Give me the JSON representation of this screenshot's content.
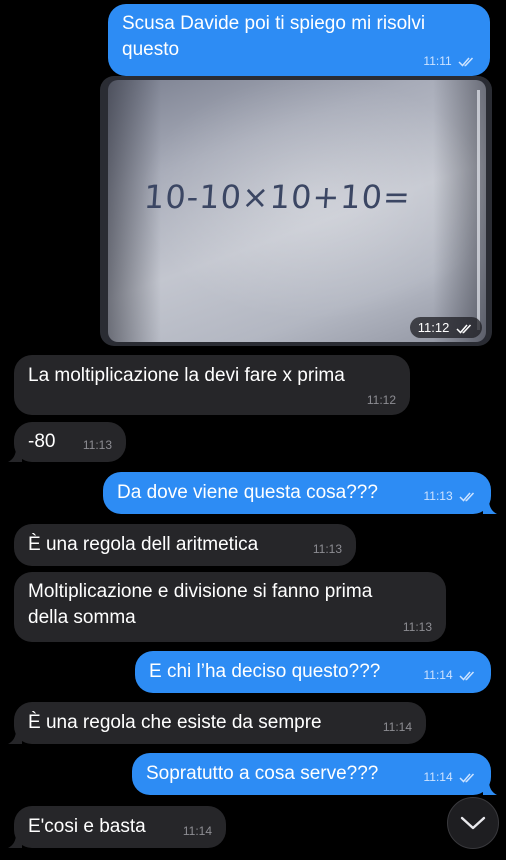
{
  "messages": [
    {
      "text": "Scusa Davide poi ti spiego mi risolvi\nquesto",
      "time": "11:11"
    },
    {
      "photo_text": "10-10×10+10=",
      "time": "11:12"
    },
    {
      "text": "La moltiplicazione la devi fare x prima",
      "time": "11:12"
    },
    {
      "text": "-80",
      "time": "11:13"
    },
    {
      "text": "Da dove viene questa cosa???",
      "time": "11:13"
    },
    {
      "text": "È una regola dell aritmetica",
      "time": "11:13"
    },
    {
      "text": "Moltiplicazione e divisione si fanno prima\ndella somma",
      "time": "11:13"
    },
    {
      "text": "E chi l’ha deciso questo???",
      "time": "11:14"
    },
    {
      "text": "È una regola che esiste da sempre",
      "time": "11:14"
    },
    {
      "text": "Sopratutto a cosa serve???",
      "time": "11:14"
    },
    {
      "text": "E'cosi e basta",
      "time": "11:14"
    }
  ],
  "colors": {
    "outgoing": "#2d8cf4",
    "incoming": "#262629",
    "background": "#000000"
  },
  "icons": {
    "read_receipt": "double-check-icon",
    "scroll_down": "chevron-down-icon"
  }
}
